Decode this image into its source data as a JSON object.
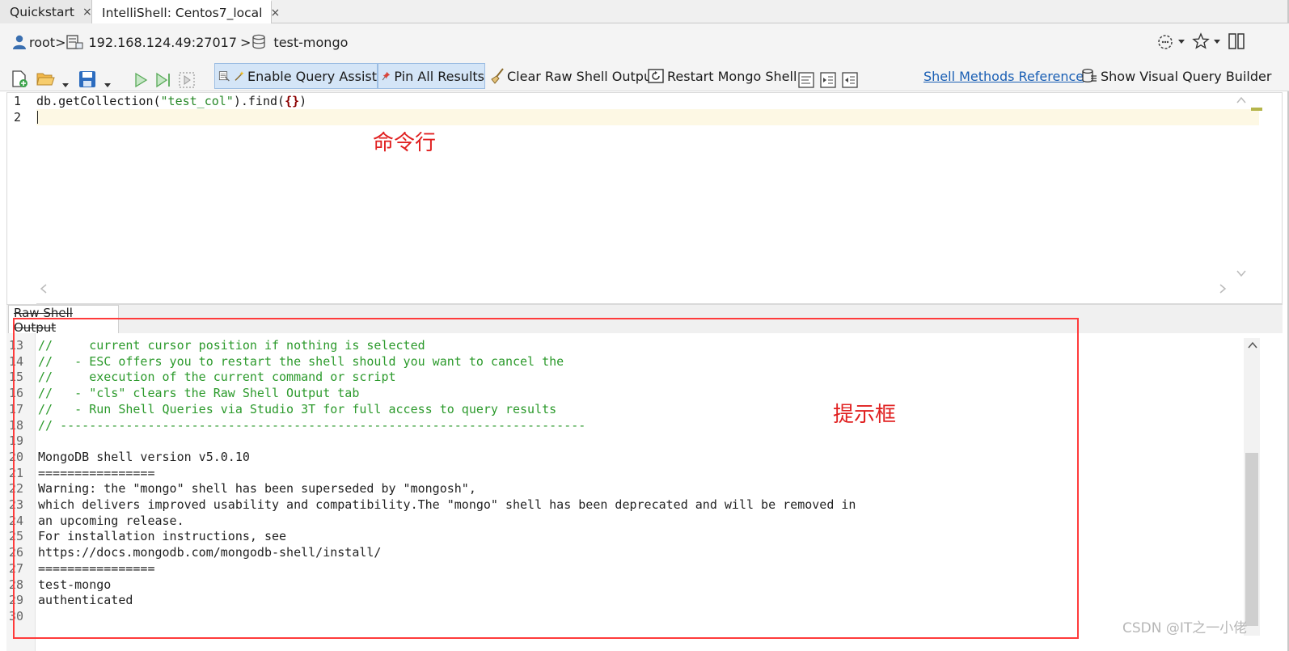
{
  "tabs": [
    {
      "label": "Quickstart",
      "close": "×"
    },
    {
      "label": "IntelliShell: Centos7_local",
      "close": "×"
    }
  ],
  "connection": {
    "user": "root",
    "host": "192.168.124.49:27017",
    "database": "test-mongo",
    "separator": ">"
  },
  "toolbar": {
    "enable_query_assist": "Enable Query Assist",
    "pin_all_results": "Pin All Results",
    "clear_raw_shell_output": "Clear Raw Shell Output",
    "restart_mongo_shell": "Restart Mongo Shell",
    "shell_methods_reference": "Shell Methods Reference",
    "show_visual_query_builder": "Show Visual Query Builder"
  },
  "editor": {
    "line_numbers": [
      "1",
      "2"
    ],
    "code_line_1": {
      "prefix": "db.getCollection(",
      "string": "\"test_col\"",
      "mid": ").find(",
      "braces": "{}",
      "suffix": ")"
    },
    "annotation": "命令行"
  },
  "output": {
    "tab_label": "Raw Shell Output",
    "annotation": "提示框",
    "line_numbers": [
      "13",
      "14",
      "15",
      "16",
      "17",
      "18",
      "19",
      "20",
      "21",
      "22",
      "23",
      "24",
      "25",
      "26",
      "27",
      "28",
      "29",
      "30"
    ],
    "lines": [
      "//     current cursor position if nothing is selected",
      "//   - ESC offers you to restart the shell should you want to cancel the",
      "//     execution of the current command or script",
      "//   - \"cls\" clears the Raw Shell Output tab",
      "//   - Run Shell Queries via Studio 3T for full access to query results",
      "// ------------------------------------------------------------------------",
      "",
      "MongoDB shell version v5.0.10",
      "================",
      "Warning: the \"mongo\" shell has been superseded by \"mongosh\",",
      "which delivers improved usability and compatibility.The \"mongo\" shell has been deprecated and will be removed in",
      "an upcoming release.",
      "For installation instructions, see",
      "https://docs.mongodb.com/mongodb-shell/install/",
      "================",
      "test-mongo",
      "authenticated",
      ""
    ]
  },
  "watermark": "CSDN @IT之一小佬",
  "colors": {
    "comment": "#2c9a2c",
    "string": "#2a8a2a",
    "annotation_red": "#e02020",
    "link": "#1a5fb4",
    "current_line": "#fdf8e4"
  }
}
